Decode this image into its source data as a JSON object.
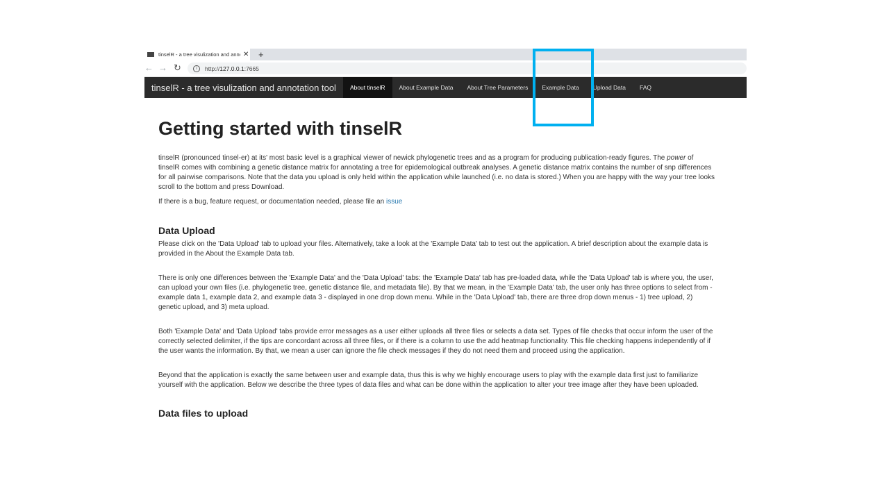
{
  "browser": {
    "tab_title": "tinselR - a tree visulization and annotation tool",
    "close_glyph": "✕",
    "new_tab_glyph": "+",
    "back_glyph": "←",
    "forward_glyph": "→",
    "reload_glyph": "↻",
    "url_prefix": "http://",
    "url_host": "127.0.0.1",
    "url_port": ":7665"
  },
  "navbar": {
    "brand": "tinselR - a tree visulization and annotation tool",
    "items": [
      "About tinselR",
      "About Example Data",
      "About Tree Parameters",
      "Example Data",
      "Upload Data",
      "FAQ"
    ],
    "active_index": 0
  },
  "highlight": {
    "color": "#00b0f0"
  },
  "main": {
    "title": "Getting started with tinselR",
    "intro_part1": "tinselR (pronounced tinsel-er) at its' most basic level is a graphical viewer of newick phylogenetic trees and as a program for producing publication-ready figures. The ",
    "intro_emphasis": "power",
    "intro_part2": " of tinselR comes with combining a genetic distance matrix for annotating a tree for epidemological outbreak analyses. A genetic distance matrix contains the number of snp differences for all pairwise comparisons. Note that the data you upload is only held within the application while launched (i.e. no data is stored.) When you are happy with the way your tree looks scroll to the bottom and press Download.",
    "bug_text": "If there is a bug, feature request, or documentation needed, please file an ",
    "bug_link": "issue",
    "section1_title": "Data Upload",
    "upload_p1": "Please click on the 'Data Upload' tab to upload your files. Alternatively, take a look at the 'Example Data' tab to test out the application. A brief description about the example data is provided in the About the Example Data tab.",
    "upload_p2": "There is only one differences between the 'Example Data' and the 'Data Upload' tabs: the 'Example Data' tab has pre-loaded data, while the 'Data Upload' tab is where you, the user, can upload your own files (i.e. phylogenetic tree, genetic distance file, and metadata file). By that we mean, in the 'Example Data' tab, the user only has three options to select from - example data 1, example data 2, and example data 3 - displayed in one drop down menu. While in the 'Data Upload' tab, there are three drop down menus - 1) tree upload, 2) genetic upload, and 3) meta upload.",
    "upload_p3": "Both 'Example Data' and 'Data Upload' tabs provide error messages as a user either uploads all three files or selects a data set. Types of file checks that occur inform the user of the correctly selected delimiter, if the tips are concordant across all three files, or if there is a column to use the add heatmap functionality. This file checking happens independently of if the user wants the information. By that, we mean a user can ignore the file check messages if they do not need them and proceed using the application.",
    "upload_p4": "Beyond that the application is exactly the same between user and example data, thus this is why we highly encourage users to play with the example data first just to familiarize yourself with the application. Below we describe the three types of data files and what can be done within the application to alter your tree image after they have been uploaded.",
    "section2_title": "Data files to upload"
  }
}
